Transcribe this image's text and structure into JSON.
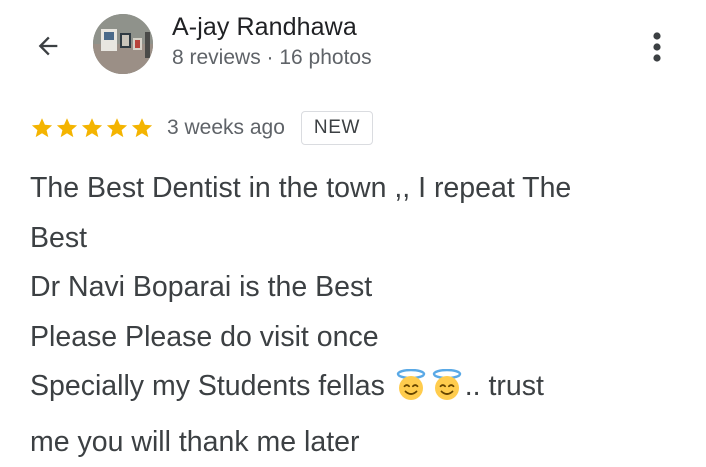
{
  "header": {
    "back_icon": "arrow-left-icon",
    "reviewer_name": "A-jay Randhawa",
    "reviewer_meta": "8 reviews · 16 photos",
    "more_icon": "more-vert-icon"
  },
  "review": {
    "rating": 5,
    "max_rating": 5,
    "star_color": "#f4b400",
    "time_ago": "3 weeks ago",
    "badge": "NEW",
    "lines": [
      "The Best Dentist in the town ,, I repeat The",
      "Best",
      "Dr Navi Boparai is the Best",
      "Please Please do visit once"
    ],
    "line5_before": "Specially my Students fellas ",
    "emoji_icon": "smiling-face-with-halo-icon",
    "line5_after": ".. trust",
    "line6": "me you will thank me later"
  }
}
